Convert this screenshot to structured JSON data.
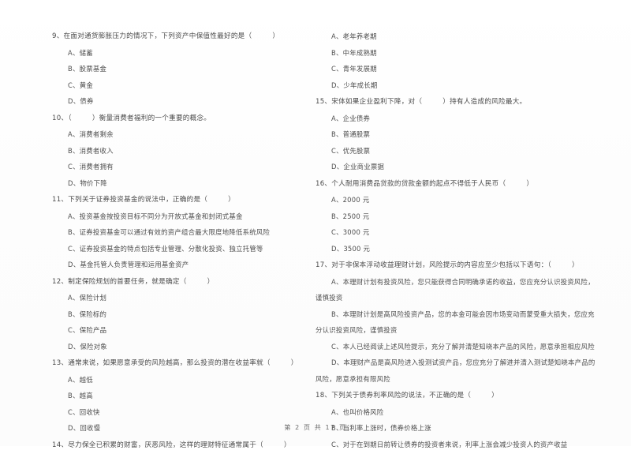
{
  "document": {
    "footer": "第 2 页 共 17 页",
    "page_number": "2",
    "total_pages": "17"
  },
  "left_column": {
    "questions": [
      {
        "number": "9",
        "stem": "9、在面对通货膨胀压力的情况下，下列资产中保值性最好的是（",
        "stem_close": "）",
        "options": [
          "A、储蓄",
          "B、股票基金",
          "C、黄金",
          "D、债券"
        ]
      },
      {
        "number": "10",
        "stem": "10、（",
        "stem_close": "）衡量消费者福利的一个重要的概念。",
        "options": [
          "A、消费者剩余",
          "B、消费者收入",
          "C、消费者拥有",
          "D、物价下降"
        ]
      },
      {
        "number": "11",
        "stem": "11、下列关于证券投资基金的说法中，正确的是（",
        "stem_close": "）",
        "options": [
          "A、投资基金按投资目标不同分为开放式基金和封闭式基金",
          "B、证券投资基金可以通过有效的资产组合最大限度地降低系统风险",
          "C、证券投资基金的特点包括专业管理、分散化投资、独立托管等",
          "D、基金托管人负责管理和运用基金资产"
        ]
      },
      {
        "number": "12",
        "stem": "12、制定保险规划的首要任务，就是确定（",
        "stem_close": "）",
        "options": [
          "A、保险计划",
          "B、保险标的",
          "C、保险产品",
          "D、保险对象"
        ]
      },
      {
        "number": "13",
        "stem": "13、通常来说，如果愿意承受的风险越高，那么投资的潜在收益率就（",
        "stem_close": "）",
        "options": [
          "A、越低",
          "B、越高",
          "C、回收快",
          "D、回收慢"
        ]
      },
      {
        "number": "14",
        "stem": "14、尽力保全已积累的财富，厌恶风险，这样的理财特征通常属于（",
        "stem_close": "）",
        "options": []
      }
    ]
  },
  "right_column": {
    "continued_options": [
      "A、老年养老期",
      "B、中年成熟期",
      "C、青年发展期",
      "D、少年成长期"
    ],
    "questions": [
      {
        "number": "15",
        "stem": "15、宋体如果企业盈利下降，对（",
        "stem_close": "）持有人造成的风险最大。",
        "options": [
          "A、企业债券",
          "B、普通股票",
          "C、优先股票",
          "D、企业商业票据"
        ]
      },
      {
        "number": "16",
        "stem": "16、个人耐用消费品贷款的贷款金额的起点不得低于人民币（",
        "stem_close": "）",
        "options": [
          "A、2000 元",
          "B、2500 元",
          "C、3000 元",
          "D、3500 元"
        ]
      },
      {
        "number": "17",
        "stem": "17、对于非保本浮动收益理财计划，风险提示的内容应至少包括以下语句：（",
        "stem_close": "）",
        "options_wrapped": [
          {
            "line1": "A、本理财计划有投资风险，您只能获得合同明确承诺的收益，您应充分认识投资风险，",
            "line2": "谨慎投资"
          },
          {
            "line1": "B、本理财计划是高风险投资产品，您的本金可能会因市场变动而蒙受重大损失，您应充",
            "line2": "分认识投资风险，谨慎投资"
          },
          {
            "line1": "C、本人已经阅读上述风险提示，充分了解并清楚知晓本产品的风险，愿意承担相应风险",
            "line2": ""
          },
          {
            "line1": "D、本理财产品是高风险进入投测试资产品，您应充分了解进并清入测试楚知晓本产品的",
            "line2": "风险，愿意承担有限风险"
          }
        ]
      },
      {
        "number": "18",
        "stem": "18、下列关于债券利率风险的说法，不正确的是（",
        "stem_close": "）",
        "options": [
          "A、也叫价格风险",
          "B、当利率上涨时，债券价格上涨",
          "C、对于在到期日前转让债券的投资者来说，利率上涨会减少投资人的资产收益"
        ]
      }
    ]
  }
}
